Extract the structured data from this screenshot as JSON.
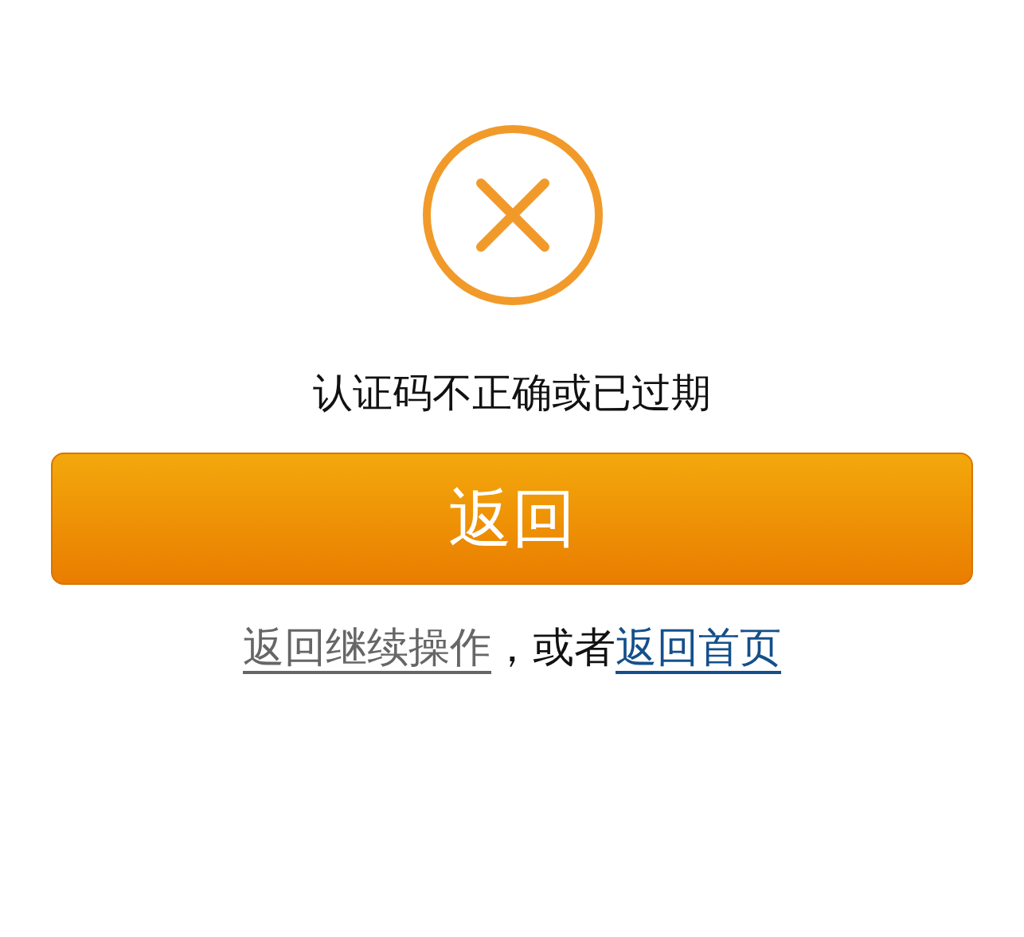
{
  "message": "认证码不正确或已过期",
  "button": "返回",
  "footer": {
    "back_link": "返回继续操作",
    "separator": "，或者",
    "home_link": "返回首页"
  }
}
